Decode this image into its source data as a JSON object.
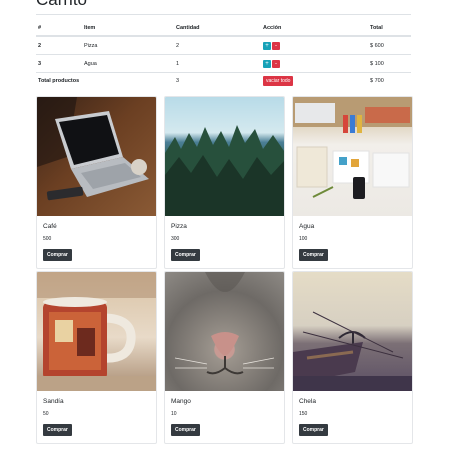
{
  "cart": {
    "title": "Carrito",
    "headers": {
      "id": "#",
      "item": "Item",
      "qty": "Cantidad",
      "action": "Acción",
      "total": "Total"
    },
    "rows": [
      {
        "id": "2",
        "item": "Pizza",
        "qty": "2",
        "total": "$ 600"
      },
      {
        "id": "3",
        "item": "Agua",
        "qty": "1",
        "total": "$ 100"
      }
    ],
    "plus_label": "+",
    "minus_label": "-",
    "footer": {
      "label": "Total productos",
      "qty": "3",
      "empty_label": "vaciar todo",
      "total": "$ 700"
    }
  },
  "products": [
    {
      "name": "Café",
      "price": "500",
      "buy_label": "Comprar"
    },
    {
      "name": "Pizza",
      "price": "300",
      "buy_label": "Comprar"
    },
    {
      "name": "Agua",
      "price": "100",
      "buy_label": "Comprar"
    },
    {
      "name": "Sandía",
      "price": "50",
      "buy_label": "Comprar"
    },
    {
      "name": "Mango",
      "price": "10",
      "buy_label": "Comprar"
    },
    {
      "name": "Chela",
      "price": "150",
      "buy_label": "Comprar"
    }
  ]
}
